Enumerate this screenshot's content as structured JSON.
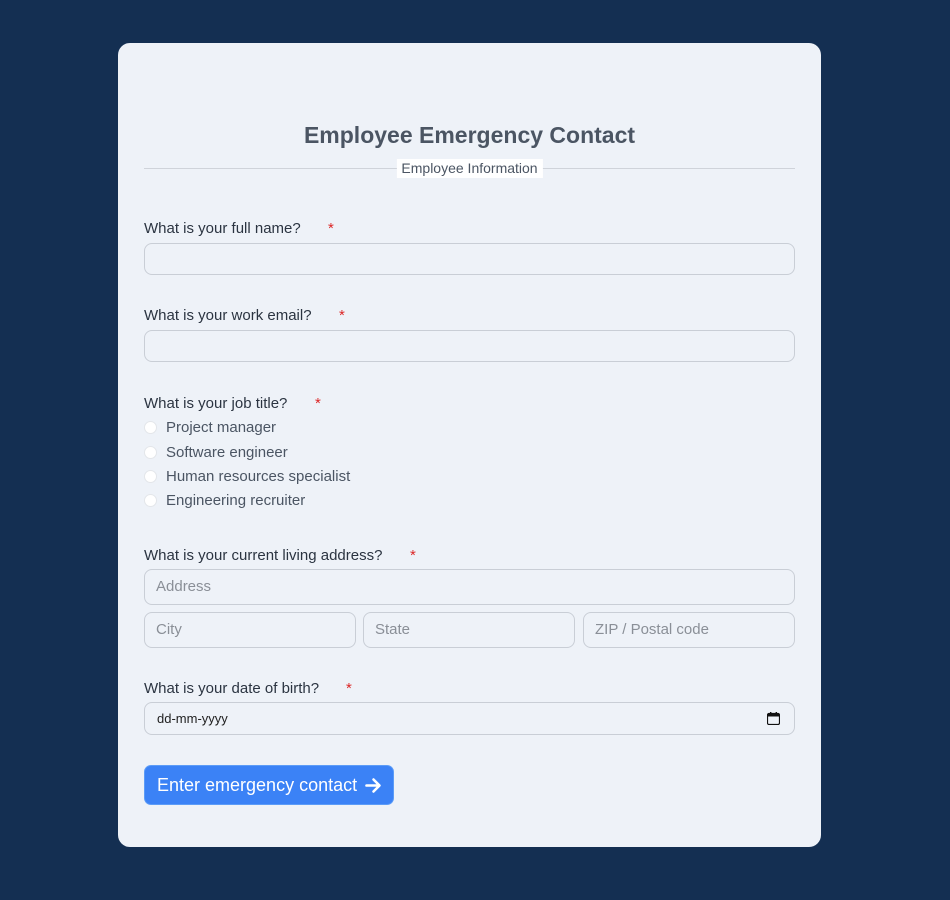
{
  "form": {
    "title": "Employee Emergency Contact",
    "section_label": "Employee Information",
    "required_mark": "*",
    "questions": {
      "full_name": "What is your full name?",
      "work_email": "What is your work email?",
      "job_title": "What is your job title?",
      "address": "What is your current living address?",
      "dob": "What is your date of birth?"
    },
    "job_options": [
      "Project manager",
      "Software engineer",
      "Human resources specialist",
      "Engineering recruiter"
    ],
    "address_placeholders": {
      "address": "Address",
      "city": "City",
      "state": "State",
      "zip": "ZIP / Postal code"
    },
    "dob_value": "dd-mm-yyyy",
    "submit_label": "Enter emergency contact"
  },
  "colors": {
    "background": "#142f52",
    "card": "#eef2f8",
    "button": "#3b82f6",
    "required": "#dc2626"
  },
  "icons": {
    "submit": "arrow-right-icon",
    "date": "calendar-icon"
  }
}
